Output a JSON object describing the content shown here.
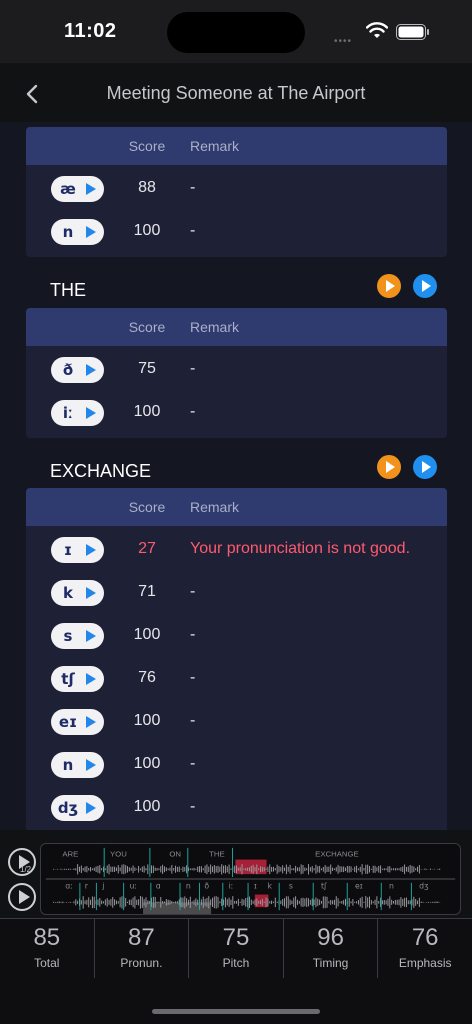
{
  "status": {
    "time": "11:02"
  },
  "nav": {
    "title": "Meeting Someone at The Airport"
  },
  "columns": {
    "score": "Score",
    "remark": "Remark"
  },
  "cards": [
    {
      "word": "",
      "rows": [
        {
          "phoneme": "æ",
          "score": "88",
          "remark": "-",
          "bad": false
        },
        {
          "phoneme": "n",
          "score": "100",
          "remark": "-",
          "bad": false
        }
      ]
    },
    {
      "word": "THE",
      "rows": [
        {
          "phoneme": "ð",
          "score": "75",
          "remark": "-",
          "bad": false
        },
        {
          "phoneme": "iː",
          "score": "100",
          "remark": "-",
          "bad": false
        }
      ]
    },
    {
      "word": "EXCHANGE",
      "rows": [
        {
          "phoneme": "ɪ",
          "score": "27",
          "remark": "Your pronunciation is not good.",
          "bad": true
        },
        {
          "phoneme": "k",
          "score": "71",
          "remark": "-",
          "bad": false
        },
        {
          "phoneme": "s",
          "score": "100",
          "remark": "-",
          "bad": false
        },
        {
          "phoneme": "tʃ",
          "score": "76",
          "remark": "-",
          "bad": false
        },
        {
          "phoneme": "eɪ",
          "score": "100",
          "remark": "-",
          "bad": false
        },
        {
          "phoneme": "n",
          "score": "100",
          "remark": "-",
          "bad": false
        },
        {
          "phoneme": "dʒ",
          "score": "100",
          "remark": "-",
          "bad": false
        }
      ]
    }
  ],
  "waveform": {
    "speed_label": "1/2",
    "words": [
      "ARE",
      "YOU",
      "ON",
      "THE",
      "EXCHANGE"
    ],
    "phonemes": [
      "ɑː",
      "r",
      "j",
      "uː",
      "ɑ",
      "n",
      "ð",
      "iː",
      "ɪ",
      "k",
      "s",
      "tʃ",
      "eɪ",
      "n",
      "dʒ"
    ]
  },
  "scores": [
    {
      "value": "85",
      "label": "Total"
    },
    {
      "value": "87",
      "label": "Pronun."
    },
    {
      "value": "75",
      "label": "Pitch"
    },
    {
      "value": "96",
      "label": "Timing"
    },
    {
      "value": "76",
      "label": "Emphasis"
    }
  ],
  "colors": {
    "bad": "#ff5a6e",
    "header": "#2f3a6e",
    "accent_blue": "#1f8ff0",
    "accent_orange": "#f0921c"
  }
}
